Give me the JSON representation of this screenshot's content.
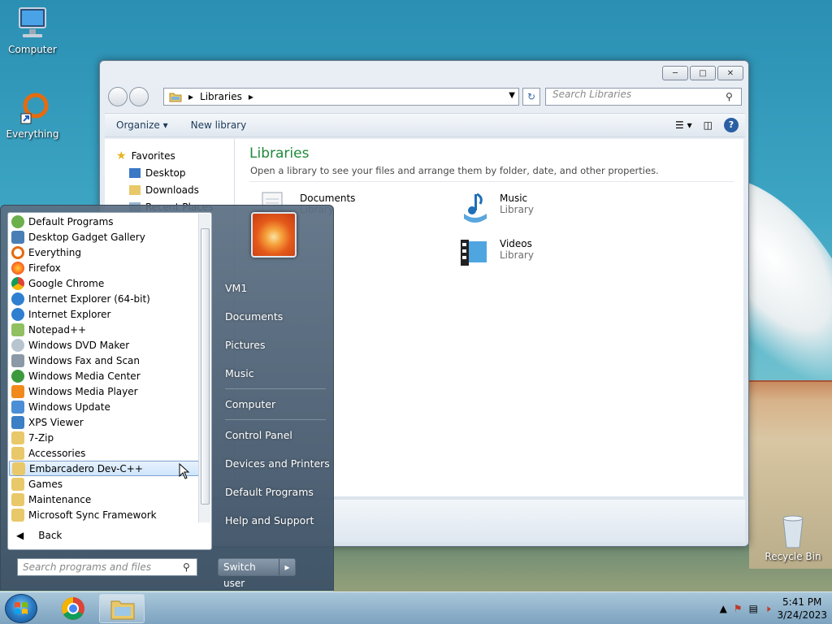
{
  "desktop": {
    "icons": [
      {
        "label": "Computer"
      },
      {
        "label": "Everything"
      },
      {
        "label": "Recycle Bin"
      }
    ]
  },
  "explorer": {
    "address_label": "Libraries",
    "search_placeholder": "Search Libraries",
    "toolbar": {
      "organize": "Organize ▾",
      "new_library": "New library"
    },
    "nav": {
      "favorites": "Favorites",
      "desktop": "Desktop",
      "downloads": "Downloads",
      "recent": "Recent Places"
    },
    "content": {
      "title": "Libraries",
      "subtitle": "Open a library to see your files and arrange them by folder, date, and other properties.",
      "libraries": [
        {
          "name": "Documents",
          "type": "Library"
        },
        {
          "name": "Music",
          "type": "Library"
        },
        {
          "name": "Videos",
          "type": "Library"
        }
      ]
    }
  },
  "start_menu": {
    "programs": [
      "Default Programs",
      "Desktop Gadget Gallery",
      "Everything",
      "Firefox",
      "Google Chrome",
      "Internet Explorer (64-bit)",
      "Internet Explorer",
      "Notepad++",
      "Windows DVD Maker",
      "Windows Fax and Scan",
      "Windows Media Center",
      "Windows Media Player",
      "Windows Update",
      "XPS Viewer",
      "7-Zip",
      "Accessories",
      "Embarcadero Dev-C++",
      "Games",
      "Maintenance",
      "Microsoft Sync Framework"
    ],
    "back": "Back",
    "search_placeholder": "Search programs and files",
    "right_links": [
      "VM1",
      "Documents",
      "Pictures",
      "Music",
      "Computer",
      "Control Panel",
      "Devices and Printers",
      "Default Programs",
      "Help and Support"
    ],
    "switch_user": "Switch user"
  },
  "taskbar": {
    "time": "5:41 PM",
    "date": "3/24/2023"
  }
}
